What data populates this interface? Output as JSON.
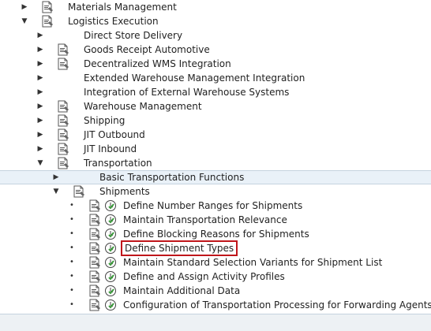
{
  "tree": [
    {
      "label": "Materials Management",
      "level": 0,
      "expander": "collapsed",
      "doc": true,
      "clock": false,
      "highlight": false,
      "boxed": false
    },
    {
      "label": "Logistics Execution",
      "level": 0,
      "expander": "expanded",
      "doc": true,
      "clock": false,
      "highlight": false,
      "boxed": false
    },
    {
      "label": "Direct Store Delivery",
      "level": 1,
      "expander": "collapsed",
      "doc": false,
      "clock": false,
      "highlight": false,
      "boxed": false
    },
    {
      "label": "Goods Receipt Automotive",
      "level": 1,
      "expander": "collapsed",
      "doc": true,
      "clock": false,
      "highlight": false,
      "boxed": false
    },
    {
      "label": "Decentralized WMS Integration",
      "level": 1,
      "expander": "collapsed",
      "doc": true,
      "clock": false,
      "highlight": false,
      "boxed": false
    },
    {
      "label": "Extended Warehouse Management Integration",
      "level": 1,
      "expander": "collapsed",
      "doc": false,
      "clock": false,
      "highlight": false,
      "boxed": false
    },
    {
      "label": "Integration of External Warehouse Systems",
      "level": 1,
      "expander": "collapsed",
      "doc": false,
      "clock": false,
      "highlight": false,
      "boxed": false
    },
    {
      "label": "Warehouse Management",
      "level": 1,
      "expander": "collapsed",
      "doc": true,
      "clock": false,
      "highlight": false,
      "boxed": false
    },
    {
      "label": "Shipping",
      "level": 1,
      "expander": "collapsed",
      "doc": true,
      "clock": false,
      "highlight": false,
      "boxed": false
    },
    {
      "label": "JIT Outbound",
      "level": 1,
      "expander": "collapsed",
      "doc": true,
      "clock": false,
      "highlight": false,
      "boxed": false
    },
    {
      "label": "JIT Inbound",
      "level": 1,
      "expander": "collapsed",
      "doc": true,
      "clock": false,
      "highlight": false,
      "boxed": false
    },
    {
      "label": "Transportation",
      "level": 1,
      "expander": "expanded",
      "doc": true,
      "clock": false,
      "highlight": false,
      "boxed": false
    },
    {
      "label": "Basic Transportation Functions",
      "level": 2,
      "expander": "collapsed",
      "doc": false,
      "clock": false,
      "highlight": true,
      "boxed": false
    },
    {
      "label": "Shipments",
      "level": 2,
      "expander": "expanded",
      "doc": true,
      "clock": false,
      "highlight": false,
      "boxed": false
    },
    {
      "label": "Define Number Ranges for Shipments",
      "level": 3,
      "expander": "leaf",
      "doc": true,
      "clock": true,
      "highlight": false,
      "boxed": false
    },
    {
      "label": "Maintain Transportation Relevance",
      "level": 3,
      "expander": "leaf",
      "doc": true,
      "clock": true,
      "highlight": false,
      "boxed": false
    },
    {
      "label": "Define Blocking Reasons for Shipments",
      "level": 3,
      "expander": "leaf",
      "doc": true,
      "clock": true,
      "highlight": false,
      "boxed": false
    },
    {
      "label": "Define Shipment Types",
      "level": 3,
      "expander": "leaf",
      "doc": true,
      "clock": true,
      "highlight": false,
      "boxed": true
    },
    {
      "label": "Maintain Standard Selection Variants for Shipment List",
      "level": 3,
      "expander": "leaf",
      "doc": true,
      "clock": true,
      "highlight": false,
      "boxed": false
    },
    {
      "label": "Define and Assign Activity Profiles",
      "level": 3,
      "expander": "leaf",
      "doc": true,
      "clock": true,
      "highlight": false,
      "boxed": false
    },
    {
      "label": "Maintain Additional Data",
      "level": 3,
      "expander": "leaf",
      "doc": true,
      "clock": true,
      "highlight": false,
      "boxed": false
    },
    {
      "label": "Configuration of Transportation Processing for Forwarding Agents",
      "level": 3,
      "expander": "leaf",
      "doc": true,
      "clock": true,
      "highlight": false,
      "boxed": false
    }
  ],
  "colors": {
    "highlight_border": "#c0161b",
    "clock_green": "#3a9a3a",
    "row_highlight": "#e9f1f8"
  }
}
